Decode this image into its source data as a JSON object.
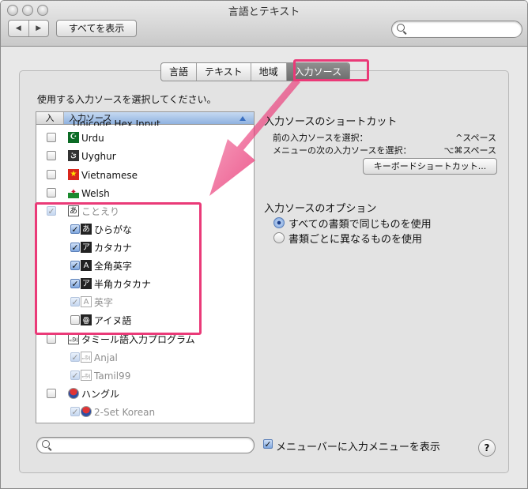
{
  "window": {
    "title": "言語とテキスト"
  },
  "toolbar": {
    "back": "◀",
    "forward": "▶",
    "show_all": "すべてを表示",
    "search_placeholder": ""
  },
  "tabs": [
    "言語",
    "テキスト",
    "地域",
    "入力ソース"
  ],
  "active_tab": "入力ソース",
  "instruction": "使用する入力ソースを選択してください。",
  "list": {
    "col_enabled": "入",
    "col_source": "入力ソース",
    "clipped_row": "Unicode Hex Input",
    "rows": [
      {
        "label": "Urdu",
        "icon": "pakistan-flag-icon",
        "glyph": "☪",
        "checked": false,
        "dim": false
      },
      {
        "label": "Uyghur",
        "icon": "uyghur-script-icon",
        "glyph": "ئ",
        "checked": false,
        "dim": false
      },
      {
        "label": "Vietnamese",
        "icon": "vietnam-flag-icon",
        "glyph": "★",
        "checked": false,
        "dim": false
      },
      {
        "label": "Welsh",
        "icon": "wales-flag-icon",
        "glyph": "✦",
        "checked": false,
        "dim": false
      },
      {
        "label": "ことえり",
        "icon": "kotoeri-icon",
        "glyph": "あ",
        "checked": true,
        "dim": true
      },
      {
        "label": "ひらがな",
        "icon": "hiragana-icon",
        "glyph": "あ",
        "checked": true,
        "dim": false
      },
      {
        "label": "カタカナ",
        "icon": "katakana-icon",
        "glyph": "ア",
        "checked": true,
        "dim": false
      },
      {
        "label": "全角英字",
        "icon": "fullwidth-alpha-icon",
        "glyph": "A",
        "checked": true,
        "dim": false
      },
      {
        "label": "半角カタカナ",
        "icon": "halfwidth-katakana-icon",
        "glyph": "ア",
        "checked": true,
        "dim": false
      },
      {
        "label": "英字",
        "icon": "romaji-icon",
        "glyph": "A",
        "checked": true,
        "dim": true
      },
      {
        "label": "アイヌ語",
        "icon": "ainu-icon",
        "glyph": "ꙮ",
        "checked": false,
        "dim": false
      },
      {
        "label": "タミール語入力プログラム",
        "icon": "tamil-icon",
        "glyph": "அ",
        "checked": false,
        "dim": false
      },
      {
        "label": "Anjal",
        "icon": "anjal-icon",
        "glyph": "அ",
        "checked": true,
        "dim": true
      },
      {
        "label": "Tamil99",
        "icon": "tamil99-icon",
        "glyph": "அ",
        "checked": true,
        "dim": true
      },
      {
        "label": "ハングル",
        "icon": "korea-flag-icon",
        "glyph": "",
        "checked": false,
        "dim": false
      },
      {
        "label": "2-Set Korean",
        "icon": "korean-2set-icon",
        "glyph": "",
        "checked": true,
        "dim": true
      }
    ]
  },
  "shortcuts": {
    "title": "入力ソースのショートカット",
    "prev_label": "前の入力ソースを選択：",
    "prev_value": "^スペース",
    "next_label": "メニューの次の入力ソースを選択：",
    "next_value": "⌥⌘スペース",
    "button": "キーボードショートカット..."
  },
  "options": {
    "title": "入力ソースのオプション",
    "opt1": "すべての書類で同じものを使用",
    "opt2": "書類ごとに異なるものを使用",
    "selected": 1
  },
  "bottom": {
    "menu_checkbox": "メニューバーに入力メニューを表示",
    "menu_checked": true,
    "help": "?"
  },
  "colors": {
    "highlight": "#ea3a78",
    "accent": "#5a7fb8"
  }
}
